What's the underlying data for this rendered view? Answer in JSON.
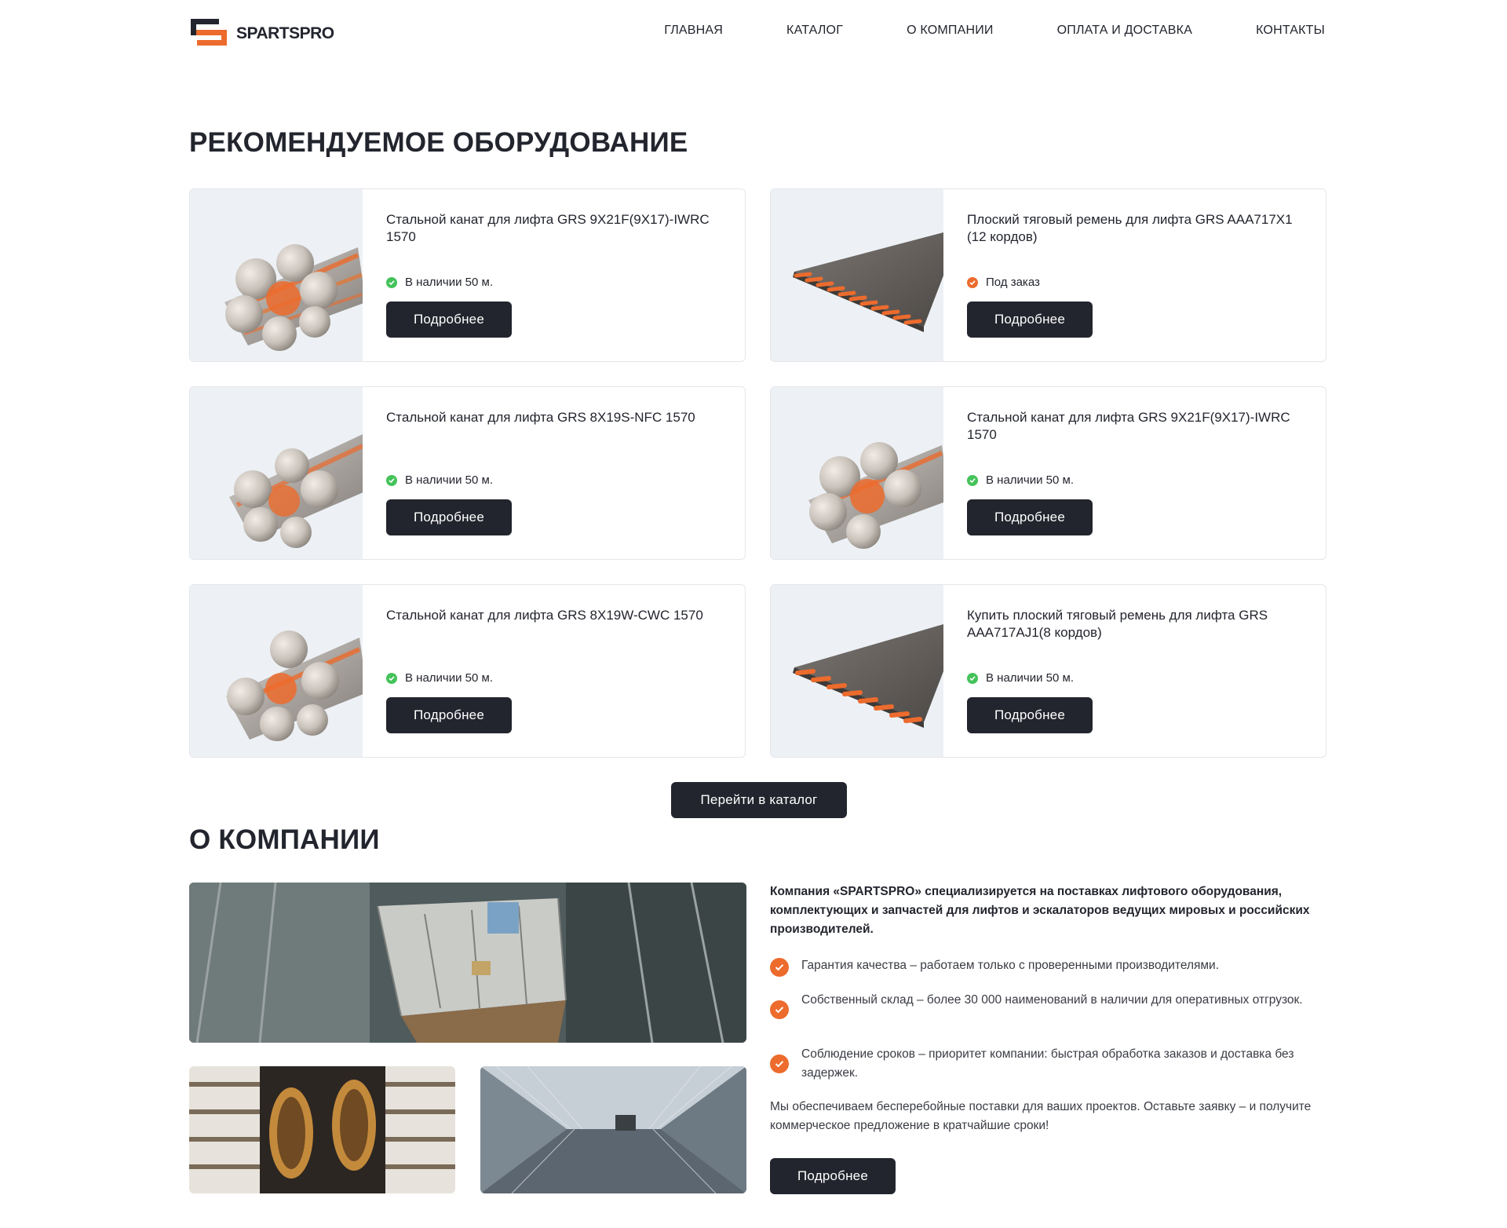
{
  "brand": {
    "name": "SPARTSPRO",
    "accent": "#ec6b2d",
    "dark": "#23252e"
  },
  "nav": [
    "ГЛАВНАЯ",
    "КАТАЛОГ",
    "О КОМПАНИИ",
    "ОПЛАТА И ДОСТАВКА",
    "КОНТАКТЫ"
  ],
  "featured": {
    "title": "РЕКОМЕНДУЕМОЕ ОБОРУДОВАНИЕ",
    "products": [
      {
        "name": "Стальной канат для лифта GRS 9X21F(9X17)-IWRC 1570",
        "status": "В наличии 50 м.",
        "status_type": "in-stock",
        "image": "steel-rope-image",
        "button": "Подробнее"
      },
      {
        "name": "Плоский тяговый ремень для лифта GRS AAA717X1 (12 кордов)",
        "status": "Под заказ",
        "status_type": "on-order",
        "image": "flat-belt-image",
        "button": "Подробнее"
      },
      {
        "name": "Стальной канат для лифта GRS 8X19S-NFC 1570",
        "status": "В наличии 50 м.",
        "status_type": "in-stock",
        "image": "steel-rope-image",
        "button": "Подробнее"
      },
      {
        "name": "Стальной канат для лифта GRS 9X21F(9X17)-IWRC 1570",
        "status": "В наличии 50 м.",
        "status_type": "in-stock",
        "image": "steel-rope-image",
        "button": "Подробнее"
      },
      {
        "name": "Стальной канат для лифта GRS 8X19W-CWC 1570",
        "status": "В наличии 50 м.",
        "status_type": "in-stock",
        "image": "steel-rope-image",
        "button": "Подробнее"
      },
      {
        "name": "Купить плоский тяговый ремень для лифта GRS AAA717AJ1(8 кордов)",
        "status": "В наличии 50 м.",
        "status_type": "in-stock",
        "image": "flat-belt-image",
        "button": "Подробнее"
      }
    ],
    "catalog_button": "Перейти в каталог"
  },
  "about": {
    "title": "О КОМПАНИИ",
    "lead": "Компания «SPARTSPRO» специализируется на поставках лифтового оборудования, комплектующих и запчастей для лифтов и эскалаторов ведущих мировых и российских производителей.",
    "features": [
      "Гарантия качества – работаем только с проверенными производителями.",
      "Собственный склад – более 30 000 наименований в наличии для оперативных отгрузок.",
      "Соблюдение сроков – приоритет компании: быстрая обработка заказов и доставка без задержек."
    ],
    "text": "Мы обеспечиваем бесперебойные поставки для ваших проектов. Оставьте заявку – и получите коммерческое предложение в кратчайшие сроки!",
    "button": "Подробнее"
  }
}
